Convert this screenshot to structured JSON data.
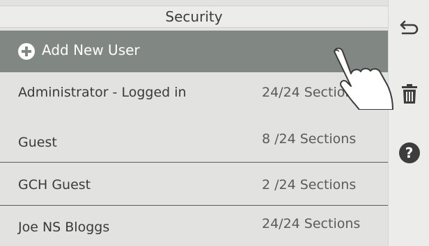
{
  "header": {
    "title": "Security"
  },
  "add_user": {
    "label": "Add New User",
    "icon": "plus-circle-icon"
  },
  "users": [
    {
      "name": "Administrator - Logged in",
      "sections": "24/24 Sections"
    },
    {
      "name": "Guest",
      "sections": "8 /24 Sections"
    },
    {
      "name": "GCH Guest",
      "sections": "2 /24 Sections"
    },
    {
      "name": "Joe NS Bloggs",
      "sections": "24/24 Sections"
    }
  ],
  "sidebar": {
    "back": {
      "icon": "back-arrow-icon"
    },
    "delete": {
      "icon": "trash-icon"
    },
    "help": {
      "icon": "help-icon",
      "label": "?"
    }
  },
  "colors": {
    "add_row_bg": "#818783",
    "list_bg": "#e2e2e0",
    "sidebar_bg": "#ececea",
    "icon_dark": "#3d3d3d"
  }
}
